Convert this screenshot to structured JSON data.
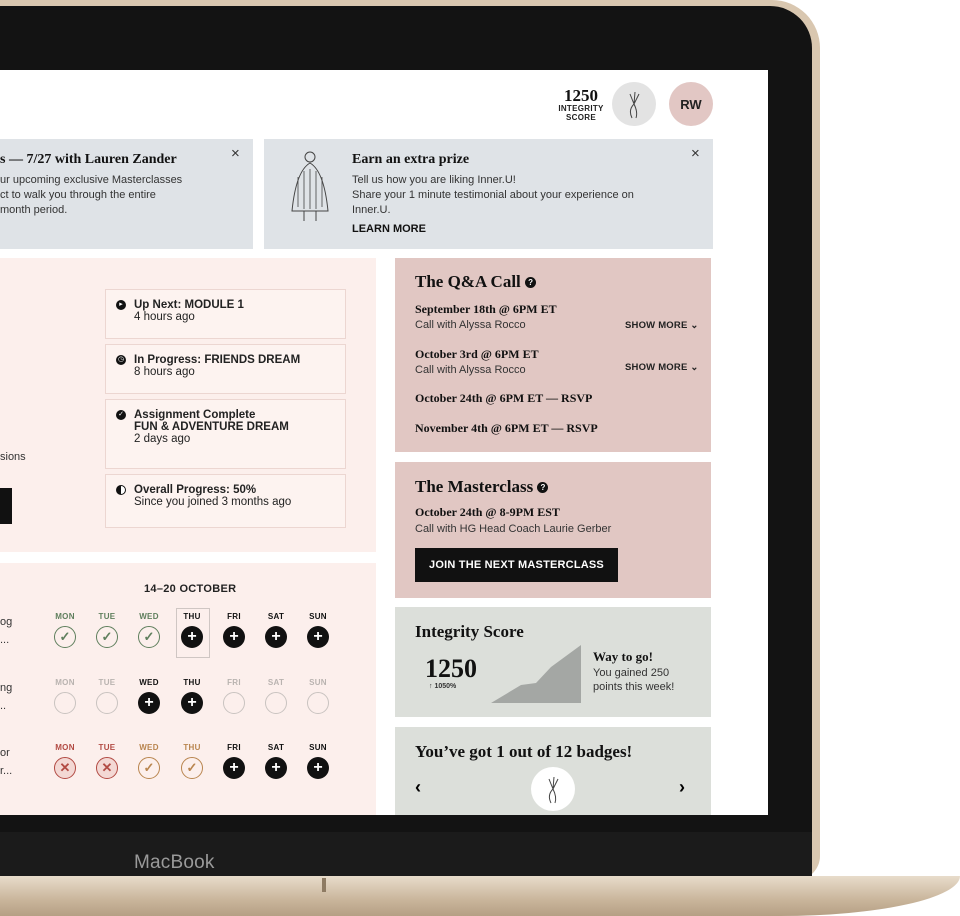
{
  "header": {
    "integrity_score": "1250",
    "integrity_label_1": "INTEGRITY",
    "integrity_label_2": "SCORE",
    "initials": "RW"
  },
  "banners": [
    {
      "title": "s — 7/27 with Lauren Zander",
      "lines": [
        "ur upcoming exclusive Masterclasses",
        "ct to walk you through the entire",
        "month period."
      ]
    },
    {
      "title": "Earn an extra prize",
      "lines": [
        "Tell us how you are liking Inner.U!",
        "Share your 1 minute testimonial about your experience on",
        "Inner.U."
      ],
      "link": "LEARN MORE"
    }
  ],
  "activity": {
    "partial_text": "sions",
    "cards": [
      {
        "icon": "arrow-right-icon",
        "label": "Up Next:",
        "value": "MODULE 1",
        "time": "4 hours ago"
      },
      {
        "icon": "clock-icon",
        "label": "In Progress:",
        "value": "FRIENDS DREAM",
        "time": "8 hours ago"
      },
      {
        "icon": "check-circle-icon",
        "label": "Assignment Complete",
        "value": "FUN & ADVENTURE DREAM",
        "time": "2 days ago"
      },
      {
        "icon": "half-circle-icon",
        "label": "Overall Progress: 50%",
        "value": "",
        "time": "Since you joined 3 months ago"
      }
    ]
  },
  "week": {
    "range": "14–20 OCTOBER",
    "days": [
      "MON",
      "TUE",
      "WED",
      "THU",
      "FRI",
      "SAT",
      "SUN"
    ],
    "rows": [
      {
        "trunc_1": "og",
        "trunc_2": "...",
        "states": [
          "done",
          "done",
          "done",
          "plus",
          "plus",
          "plus",
          "plus"
        ]
      },
      {
        "trunc_1": "ng",
        "trunc_2": "..",
        "states": [
          "empty",
          "empty",
          "plus",
          "plus",
          "empty",
          "empty",
          "empty"
        ]
      },
      {
        "trunc_1": "or",
        "trunc_2": "r...",
        "states": [
          "miss",
          "miss",
          "done-o",
          "done-o",
          "plus",
          "plus",
          "plus"
        ]
      }
    ]
  },
  "qa": {
    "title": "The Q&A Call",
    "calls": [
      {
        "date": "September 18th @ 6PM ET",
        "sub": "Call with Alyssa Rocco",
        "more": "SHOW MORE"
      },
      {
        "date": "October 3rd @ 6PM ET",
        "sub": "Call with Alyssa Rocco",
        "more": "SHOW MORE"
      },
      {
        "date": "October 24th @ 6PM ET — RSVP"
      },
      {
        "date": "November 4th @ 6PM ET — RSVP"
      }
    ]
  },
  "masterclass": {
    "title": "The Masterclass",
    "date": "October 24th @ 8-9PM EST",
    "sub": "Call with HG Head Coach Laurie Gerber",
    "button": "JOIN THE NEXT MASTERCLASS"
  },
  "integrity": {
    "title": "Integrity Score",
    "score": "1250",
    "change": "↑ 1050%",
    "headline": "Way to go!",
    "line1": "You gained 250",
    "line2": "points this week!"
  },
  "badges": {
    "title": "You’ve got 1 out of 12 badges!"
  },
  "device": {
    "label": "MacBook"
  }
}
